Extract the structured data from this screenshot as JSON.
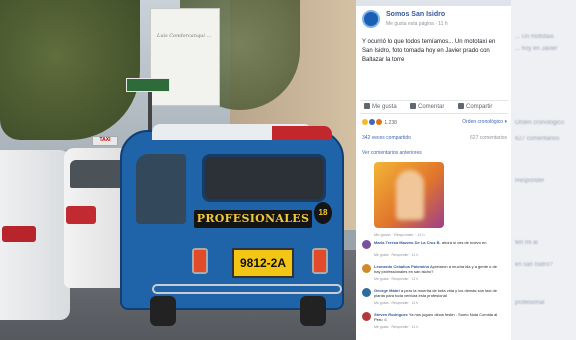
{
  "photo": {
    "billboard_text": "Luis Condorcanqui ...",
    "taxi_sign": "TAXI",
    "mototaxi_label": "PROFESIONALES",
    "badge": "18",
    "plate": "9812-2A"
  },
  "post": {
    "page_name": "Somos San Isidro",
    "meta": "Me gusta esta página · 11 h",
    "body": "Y ocurrió lo que todos temíamos... Un mototaxi en San Isidro, foto tomada hoy en Javier prado con Baltazar la torre",
    "actions": {
      "like": "Me gusta",
      "comment": "Comentar",
      "share": "Compartir"
    },
    "reaction_count": "1.238",
    "order_label": "Orden cronológico ▾",
    "shares_label": "342 veces compartido",
    "comments_count_label": "627 comentarios",
    "previous_comments": "Ver comentarios anteriores",
    "image_comment_meta": "Me gusta · Responder · 11 h",
    "comments": [
      {
        "author": "Maria Teresa Mazzeo De La Cruz B.",
        "text": "ahora si ves de nuevo en",
        "footer": "Me gusta · Responder · 11 h",
        "color": "#7a4f9b"
      },
      {
        "author": "Leonardo Ceballos Palomino",
        "text": "Apretaron a mucha ida y a gente o de hay professionales en san isidro?",
        "footer": "Me gusta · Responder · 11 h",
        "color": "#d08a2b"
      },
      {
        "author": "George Mabri",
        "text": "a pero la muertía de toda vida y los demás son taxi de planta para toda ventura esta profesional",
        "footer": "Me gusta · Responder · 11 h",
        "color": "#2d6d9e"
      },
      {
        "author": "Steven Rodriguez",
        "text": "Ya nos jugaro dinos festin - Somo Nota Comida al Peru ☺",
        "footer": "Me gusta · Responder · 11 h",
        "color": "#b33a3a"
      }
    ]
  },
  "background_text": [
    "... Un mototaxi",
    "... hoy en Javier",
    "Orden cronológico",
    "627 comentarios",
    "Responder",
    "ten mi al",
    "en san Isidro?",
    "profesional"
  ]
}
